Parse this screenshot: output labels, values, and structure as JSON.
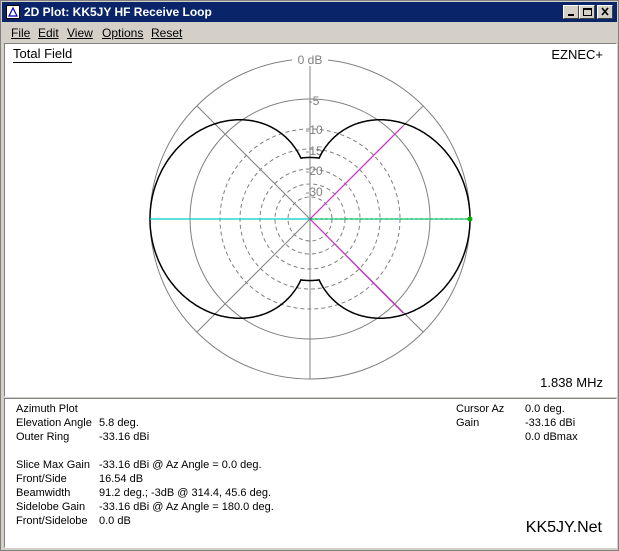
{
  "window": {
    "title": "2D Plot: KK5JY HF Receive Loop",
    "controls": {
      "minimize": "minimize",
      "maximize": "maximize",
      "close": "close"
    }
  },
  "menu": [
    {
      "label": "File"
    },
    {
      "label": "Edit"
    },
    {
      "label": "View"
    },
    {
      "label": "Options"
    },
    {
      "label": "Reset"
    }
  ],
  "plot": {
    "heading": "Total Field",
    "brand": "EZNEC+",
    "frequency": "1.838 MHz",
    "ring_labels": [
      "0 dB",
      "-5",
      "-10",
      "-15",
      "-20",
      "-30"
    ],
    "colors": {
      "pattern": "#000000",
      "grid": "#808080",
      "cursor": "#00cccc",
      "beamwidth": "#cc33cc",
      "marker": "#00b000"
    }
  },
  "chart_data": {
    "type": "polar",
    "title": "Total Field",
    "reference": "0 dB",
    "rings": [
      0,
      -5,
      -10,
      -15,
      -20,
      -30
    ],
    "pattern": "figure-eight azimuth pattern, maxima at 0 and 180 deg, nulls at 90 and 270 deg",
    "cursor_azimuth_deg": 0.0,
    "beamwidth_lines_deg": [
      314.4,
      45.6
    ]
  },
  "info": {
    "left": [
      {
        "label": "Azimuth Plot",
        "value": ""
      },
      {
        "label": "Elevation Angle",
        "value": "5.8 deg."
      },
      {
        "label": "Outer Ring",
        "value": "-33.16 dBi"
      },
      {
        "label": "Slice Max Gain",
        "value": "-33.16 dBi @ Az Angle = 0.0 deg."
      },
      {
        "label": "Front/Side",
        "value": "16.54 dB"
      },
      {
        "label": "Beamwidth",
        "value": "91.2 deg.; -3dB @ 314.4, 45.6 deg."
      },
      {
        "label": "Sidelobe Gain",
        "value": "-33.16 dBi @ Az Angle = 180.0 deg."
      },
      {
        "label": "Front/Sidelobe",
        "value": "0.0 dB"
      }
    ],
    "cursor": {
      "az_label": "Cursor Az",
      "az_value": "0.0 deg.",
      "gain_label": "Gain",
      "gain_value": "-33.16 dBi",
      "gain_max": "0.0 dBmax"
    },
    "site": "KK5JY.Net"
  }
}
